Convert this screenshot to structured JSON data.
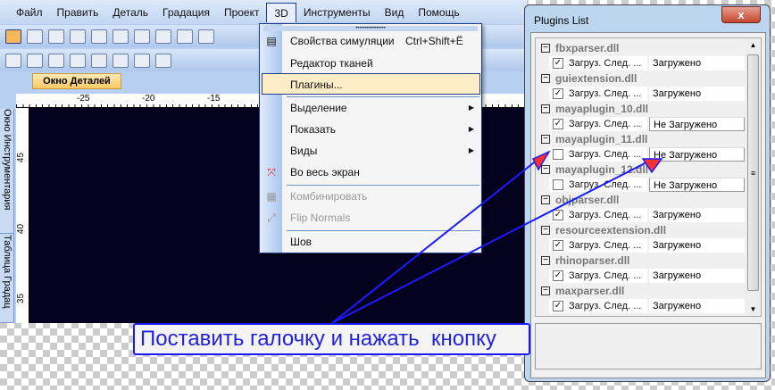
{
  "menubar": [
    "Файл",
    "Править",
    "Деталь",
    "Градация",
    "Проект",
    "3D",
    "Инструменты",
    "Вид",
    "Помощь"
  ],
  "detail_tab": "Окно Деталей",
  "ruler_h": [
    "-25",
    "-20",
    "-15"
  ],
  "ruler_v": [
    "45",
    "40",
    "35"
  ],
  "side_tabs": [
    "Окно Инструментария",
    "Таблица Градац"
  ],
  "menu3d": {
    "sim": "Свойства симуляции",
    "sim_shortcut": "Ctrl+Shift+Ё",
    "fabric": "Редактор тканей",
    "plugins": "Плагины...",
    "select": "Выделение",
    "show": "Показать",
    "views": "Виды",
    "fullscreen": "Во весь экран",
    "combine": "Комбинировать",
    "flip": "Flip Normals",
    "seam": "Шов"
  },
  "plugins": {
    "title": "Plugins List",
    "close": "x",
    "items": [
      {
        "name": "fbxparser.dll",
        "option": "Загруз. След. ...",
        "checked": true,
        "status": "Загружено"
      },
      {
        "name": "guiextension.dll",
        "option": "Загруз. След. ...",
        "checked": true,
        "status": "Загружено"
      },
      {
        "name": "mayaplugin_10.dll",
        "option": "Загруз. След. ...",
        "checked": true,
        "status": "Не Загружено"
      },
      {
        "name": "mayaplugin_11.dll",
        "option": "Загруз. След. ...",
        "checked": false,
        "status": "Не Загружено"
      },
      {
        "name": "mayaplugin_12.dll",
        "option": "Загруз. След. ...",
        "checked": false,
        "status": "Не Загружено"
      },
      {
        "name": "objparser.dll",
        "option": "Загруз. След. ...",
        "checked": true,
        "status": "Загружено"
      },
      {
        "name": "resourceextension.dll",
        "option": "Загруз. След. ...",
        "checked": true,
        "status": "Загружено"
      },
      {
        "name": "rhinoparser.dll",
        "option": "Загруз. След. ...",
        "checked": true,
        "status": "Загружено"
      },
      {
        "name": "maxparser.dll",
        "option": "Загруз. След. ...",
        "checked": true,
        "status": "Загружено"
      }
    ]
  },
  "annotation": "Поставить галочку и нажать  кнопку",
  "colors": {
    "annotation": "#1a1aff",
    "arrow_head": "#ff3030",
    "canvas": "#05021f"
  }
}
